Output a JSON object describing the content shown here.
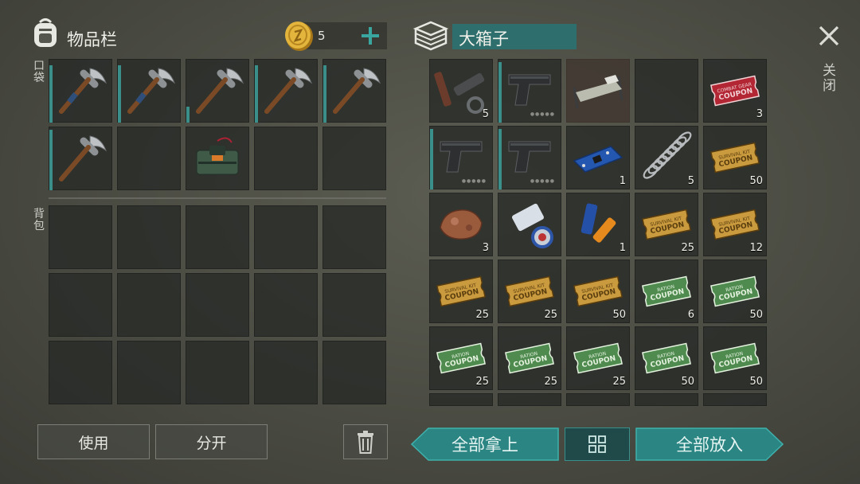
{
  "inventory": {
    "title": "物品栏",
    "coins": "5",
    "pocket_label": "口袋",
    "backpack_label": "背包",
    "pocket_slots": [
      {
        "item": "pickaxe-icon",
        "variant": "blue-wrap"
      },
      {
        "item": "pickaxe-icon",
        "variant": "blue-wrap"
      },
      {
        "item": "pickaxe-icon",
        "variant": "plain"
      },
      {
        "item": "pickaxe-icon",
        "variant": "plain"
      },
      {
        "item": "pickaxe-icon",
        "variant": "plain"
      },
      {
        "item": "pickaxe-icon",
        "variant": "plain"
      },
      {
        "item": "",
        "variant": ""
      },
      {
        "item": "c4-explosive-icon",
        "variant": ""
      },
      {
        "item": "",
        "variant": ""
      },
      {
        "item": "",
        "variant": ""
      }
    ],
    "durability": [
      0.9,
      0.9,
      0.25,
      0.9,
      0.9,
      0.95,
      0,
      0,
      0,
      0
    ],
    "use_button": "使用",
    "split_button": "分开"
  },
  "container": {
    "title": "大箱子",
    "close_label": "关闭",
    "take_all_button": "全部拿上",
    "put_all_button": "全部放入",
    "slots": [
      {
        "item": "rifle-parts-icon",
        "qty": "5"
      },
      {
        "item": "pistol-icon",
        "qty": "",
        "dots": "●●●●●"
      },
      {
        "item": "bed-icon",
        "qty": ""
      },
      {
        "item": "",
        "qty": ""
      },
      {
        "item": "combat-gear-coupon-icon",
        "qty": "3"
      },
      {
        "item": "pistol-icon",
        "qty": "",
        "dots": "●●●●●"
      },
      {
        "item": "pistol-icon",
        "qty": "",
        "dots": "●●●●●"
      },
      {
        "item": "circuit-board-icon",
        "qty": "1"
      },
      {
        "item": "spring-icon",
        "qty": "5"
      },
      {
        "item": "survival-kit-coupon-icon",
        "qty": "50"
      },
      {
        "item": "ore-icon",
        "qty": "3"
      },
      {
        "item": "adhesive-tape-icon",
        "qty": ""
      },
      {
        "item": "batteries-icon",
        "qty": "1"
      },
      {
        "item": "survival-kit-coupon-icon",
        "qty": "25"
      },
      {
        "item": "survival-kit-coupon-icon",
        "qty": "12"
      },
      {
        "item": "survival-kit-coupon-icon",
        "qty": "25"
      },
      {
        "item": "survival-kit-coupon-icon",
        "qty": "25"
      },
      {
        "item": "survival-kit-coupon-icon",
        "qty": "50"
      },
      {
        "item": "ration-coupon-icon",
        "qty": "6"
      },
      {
        "item": "ration-coupon-icon",
        "qty": "50"
      },
      {
        "item": "ration-coupon-icon",
        "qty": "25"
      },
      {
        "item": "ration-coupon-icon",
        "qty": "25"
      },
      {
        "item": "ration-coupon-icon",
        "qty": "25"
      },
      {
        "item": "ration-coupon-icon",
        "qty": "50"
      },
      {
        "item": "ration-coupon-icon",
        "qty": "50"
      }
    ],
    "coupon_text": {
      "combat": [
        "COMBAT GEAR",
        "COUPON"
      ],
      "survival": [
        "SURVIVAL KIT",
        "COUPON"
      ],
      "ration": [
        "RATION",
        "COUPON"
      ]
    }
  },
  "colors": {
    "accent_teal": "#2c8c8b",
    "survival_coupon": "#c99a3e",
    "ration_coupon": "#4f8a4f",
    "combat_coupon": "#b02a35"
  }
}
